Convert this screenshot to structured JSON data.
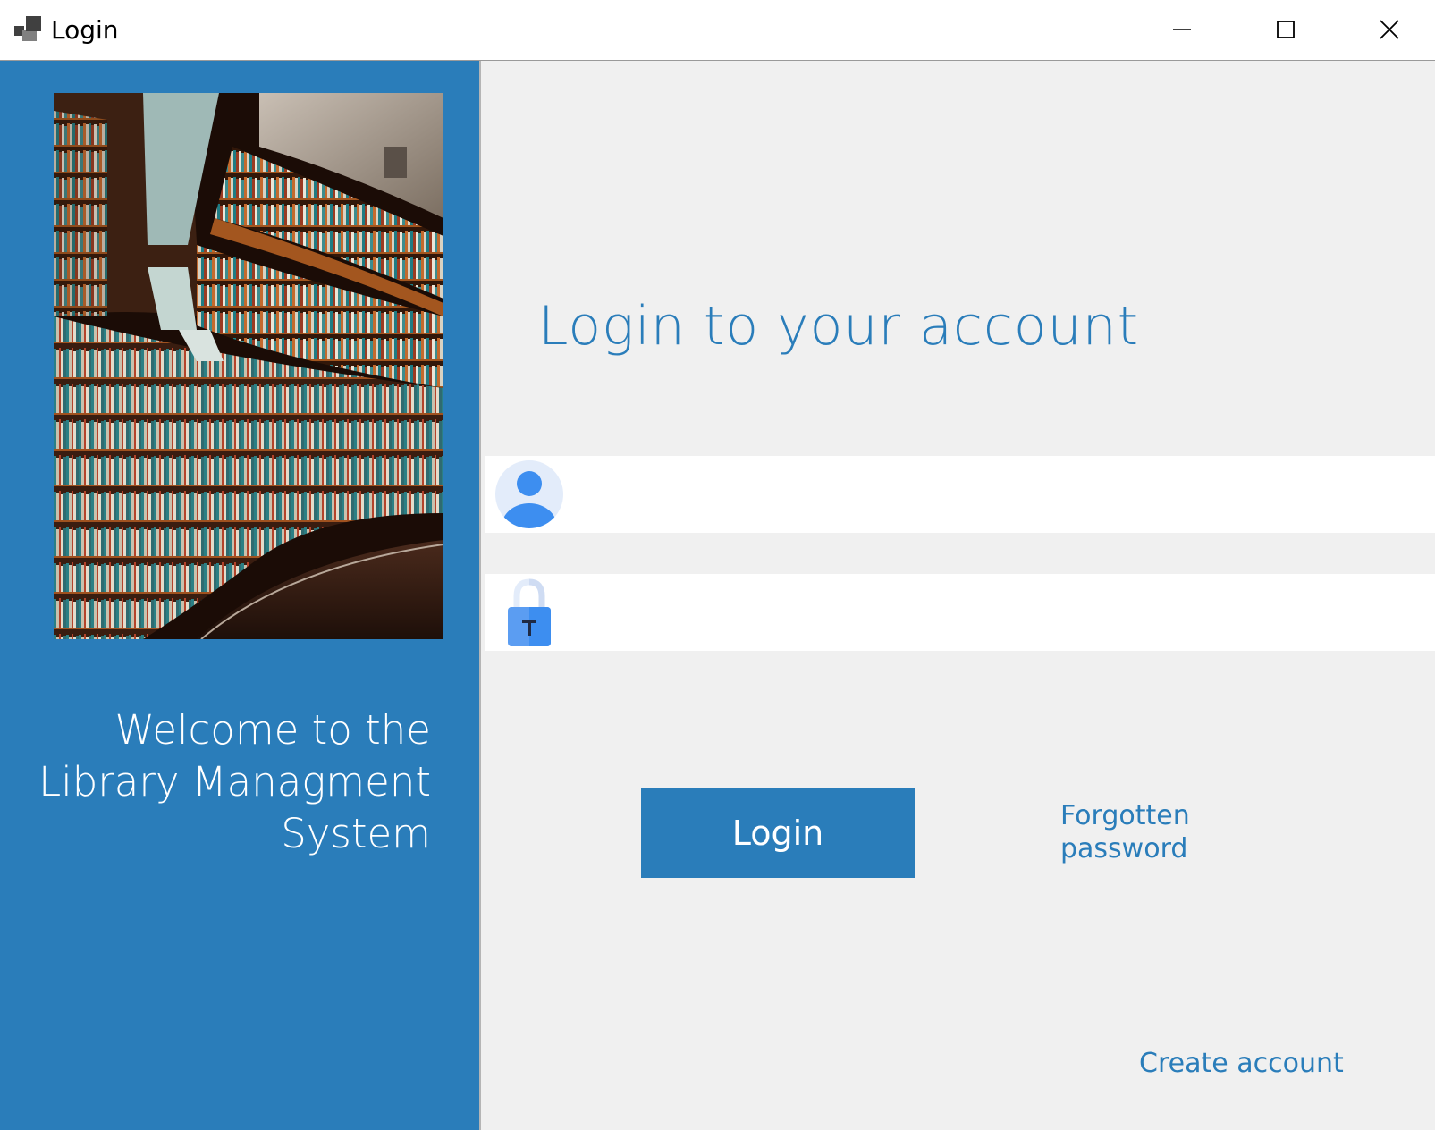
{
  "window": {
    "title": "Login",
    "controls": {
      "minimize": "minimize",
      "maximize": "maximize",
      "close": "close"
    }
  },
  "left_panel": {
    "background_color": "#2a7dba",
    "image": "library-bookshelves-photo",
    "welcome_text": "Welcome to the\nLibrary Managment\nSystem"
  },
  "right_panel": {
    "heading": "Login to your account",
    "username_field": {
      "icon": "user-avatar-icon",
      "value": "",
      "placeholder": ""
    },
    "password_field": {
      "icon": "padlock-icon",
      "value": "",
      "placeholder": ""
    },
    "login_button_label": "Login",
    "forgot_password_label": "Forgotten\npassword",
    "create_account_label": "Create account"
  },
  "colors": {
    "accent": "#2a7dba",
    "panel_bg": "#f0f0f0",
    "field_bg": "#ffffff"
  }
}
